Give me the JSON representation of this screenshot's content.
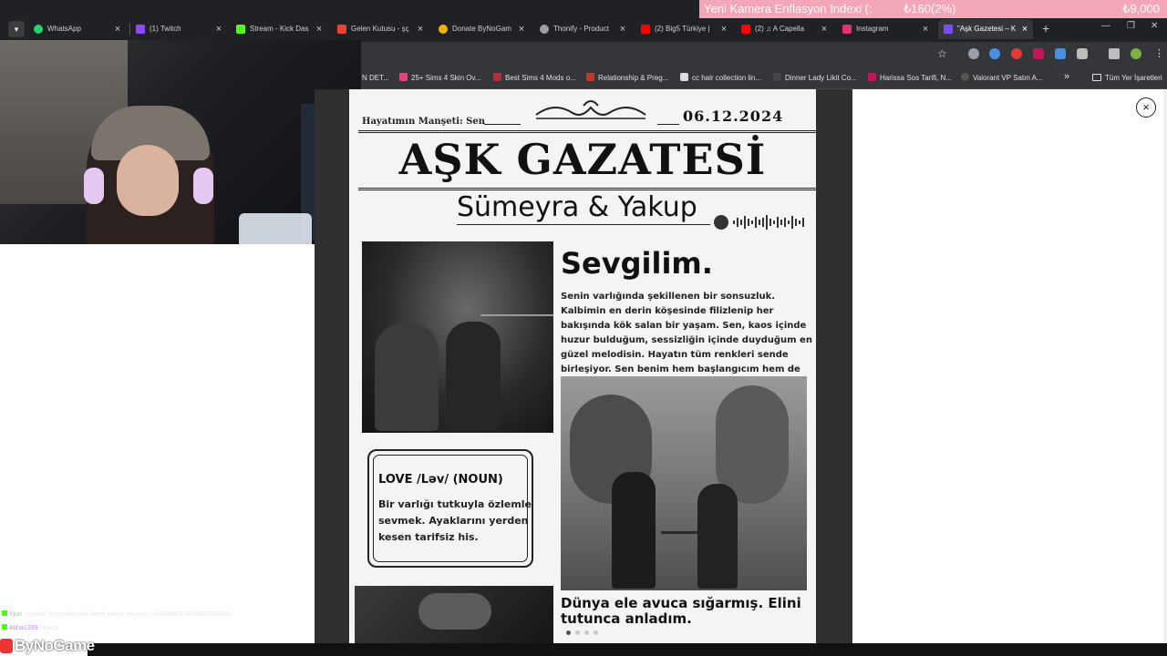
{
  "ticker": {
    "headline": "Yeni Kamera Enflasyon Indexi (:",
    "change": "₺160(2%)",
    "price": "₺9,000"
  },
  "tabs": [
    {
      "label": "WhatsApp",
      "icon": "whatsapp-icon",
      "color": "#25d366"
    },
    {
      "label": "(1) Twitch",
      "icon": "twitch-icon",
      "color": "#9146ff"
    },
    {
      "label": "Stream - Kick Das",
      "icon": "kick-icon",
      "color": "#53fc18"
    },
    {
      "label": "Gelen Kutusu - şç",
      "icon": "gmail-icon",
      "color": "#ea4335"
    },
    {
      "label": "Donate ByNoGam",
      "icon": "donate-icon",
      "color": "#f5b400"
    },
    {
      "label": "Thonify - Product",
      "icon": "globe-icon",
      "color": "#9aa0a6"
    },
    {
      "label": "(2) Big5 Türkiye |",
      "icon": "youtube-icon",
      "color": "#ff0000"
    },
    {
      "label": "(2) ♫ A Capella",
      "icon": "youtube-icon",
      "color": "#ff0000"
    },
    {
      "label": "Instagram",
      "icon": "instagram-icon",
      "color": "#e1306c"
    },
    {
      "label": "\"Aşk Gazetesi – Ki",
      "icon": "site-icon",
      "color": "#7b4dff"
    }
  ],
  "bookmarks": [
    {
      "label": "N DET...",
      "color": "#888888"
    },
    {
      "label": "25+ Sims 4 Skin Ov...",
      "color": "#e0457b"
    },
    {
      "label": "Best Sims 4 Mods o...",
      "color": "#b0303a"
    },
    {
      "label": "Relationship & Preg...",
      "color": "#c0392b"
    },
    {
      "label": "cc hair collection lin...",
      "color": "#dddddd"
    },
    {
      "label": "Dinner Lady Likit Co...",
      "color": "#444444"
    },
    {
      "label": "Harissa Sos Tarifi, N...",
      "color": "#c2185b"
    },
    {
      "label": "Valorant VP Satın A...",
      "color": "#555555"
    }
  ],
  "bookmarks_more": "»",
  "bookmarks_folder": "Tüm Yer İşaretleri",
  "newspaper": {
    "left_label": "Hayatımın Manşeti: Sen",
    "date": "06.12.2024",
    "title": "AŞK GAZATESİ",
    "couple": "Sümeyra & Yakup",
    "heading": "Sevgilim.",
    "body": "Senin varlığında şekillenen bir sonsuzluk. Kalbimin en derin köşesinde filizlenip her bakışında kök salan bir yaşam. Sen, kaos içinde huzur bulduğum, sessizliğin içinde duyduğum en güzel melodisin. Hayatın tüm renkleri sende birleşiyor. Sen benim hem başlangıcım hem de bitmeyen hikayemsin",
    "box_title": "LOVE /Ləv/ (NOUN)",
    "box_text": "Bir varlığı tutkuyla özlemle sevmek. Ayaklarını yerden kesen tarifsiz his.",
    "caption": "Dünya ele avuca sığarmış. Elini tutunca anladım."
  },
  "close_label": "×",
  "chat": [
    {
      "user": "Xjun",
      "text": ": reklam koyuşudaysak kendi sitemi sayarım LAANNNDDDFHADDWDNA"
    },
    {
      "user": "Atiha1339",
      "text": ": kuruş"
    }
  ],
  "logo": "ByNoGame",
  "accent_color": "#f2a6b8"
}
